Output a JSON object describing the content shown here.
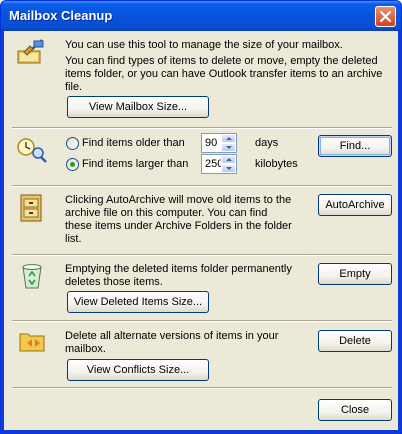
{
  "window": {
    "title": "Mailbox Cleanup"
  },
  "mailbox": {
    "text1": "You can use this tool to manage the size of your mailbox.",
    "text2_l1": "You can find types of items to delete or move, empty the deleted",
    "text2_l2": "items folder, or you can have Outlook transfer items to an archive",
    "text2_l3": "file.",
    "view_button": "View Mailbox Size..."
  },
  "find": {
    "older_label": "Find items older than",
    "older_value": "90",
    "older_unit": "days",
    "larger_label": "Find items larger than",
    "larger_value": "250",
    "larger_unit": "kilobytes",
    "selected": "larger",
    "find_button": "Find..."
  },
  "archive": {
    "text_l1": "Clicking AutoArchive will move old items to the",
    "text_l2": "archive file on this computer.  You can find",
    "text_l3": "these items under Archive Folders in the folder",
    "text_l4": "list.",
    "button": "AutoArchive"
  },
  "deleted": {
    "text_l1": "Emptying the deleted items folder permanently",
    "text_l2": "deletes those items.",
    "view_button": "View Deleted Items Size...",
    "empty_button": "Empty"
  },
  "conflicts": {
    "text_l1": "Delete all alternate versions of items in your",
    "text_l2": "mailbox.",
    "view_button": "View Conflicts Size...",
    "delete_button": "Delete"
  },
  "footer": {
    "close_button": "Close"
  }
}
